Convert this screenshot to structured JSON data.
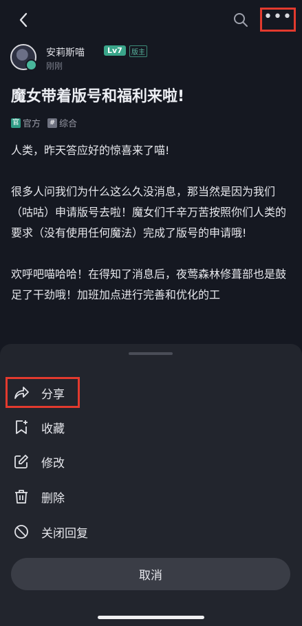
{
  "header": {
    "back_icon": "chevron-left-icon",
    "search_icon": "search-icon",
    "more_label": "•••"
  },
  "author": {
    "name": "安莉斯喵",
    "level": "Lv7",
    "role": "版主",
    "time": "刚刚"
  },
  "post": {
    "title": "魔女带着版号和福利来啦!",
    "tags": [
      {
        "icon_text": "官",
        "label": "官方"
      },
      {
        "icon_text": "#",
        "label": "综合"
      }
    ],
    "paragraphs": [
      "人类，昨天答应好的惊喜来了喵!",
      "很多人问我们为什么这么久没消息，那当然是因为我们（咕咕）申请版号去啦！魔女们千辛万苦按照你们人类的要求（没有使用任何魔法）完成了版号的申请哦!",
      "欢呼吧喵哈哈！在得知了消息后，夜莺森林修葺部也是鼓足了干劲哦！加班加点进行完善和优化的工"
    ]
  },
  "sheet": {
    "options": [
      {
        "label": "分享",
        "icon": "share-icon"
      },
      {
        "label": "收藏",
        "icon": "bookmark-add-icon"
      },
      {
        "label": "修改",
        "icon": "edit-icon"
      },
      {
        "label": "删除",
        "icon": "trash-icon"
      },
      {
        "label": "关闭回复",
        "icon": "block-icon"
      }
    ],
    "cancel_label": "取消"
  },
  "colors": {
    "highlight": "#e33a2e",
    "accent": "#3aa58a",
    "background": "#151821",
    "sheet": "#22252d"
  }
}
